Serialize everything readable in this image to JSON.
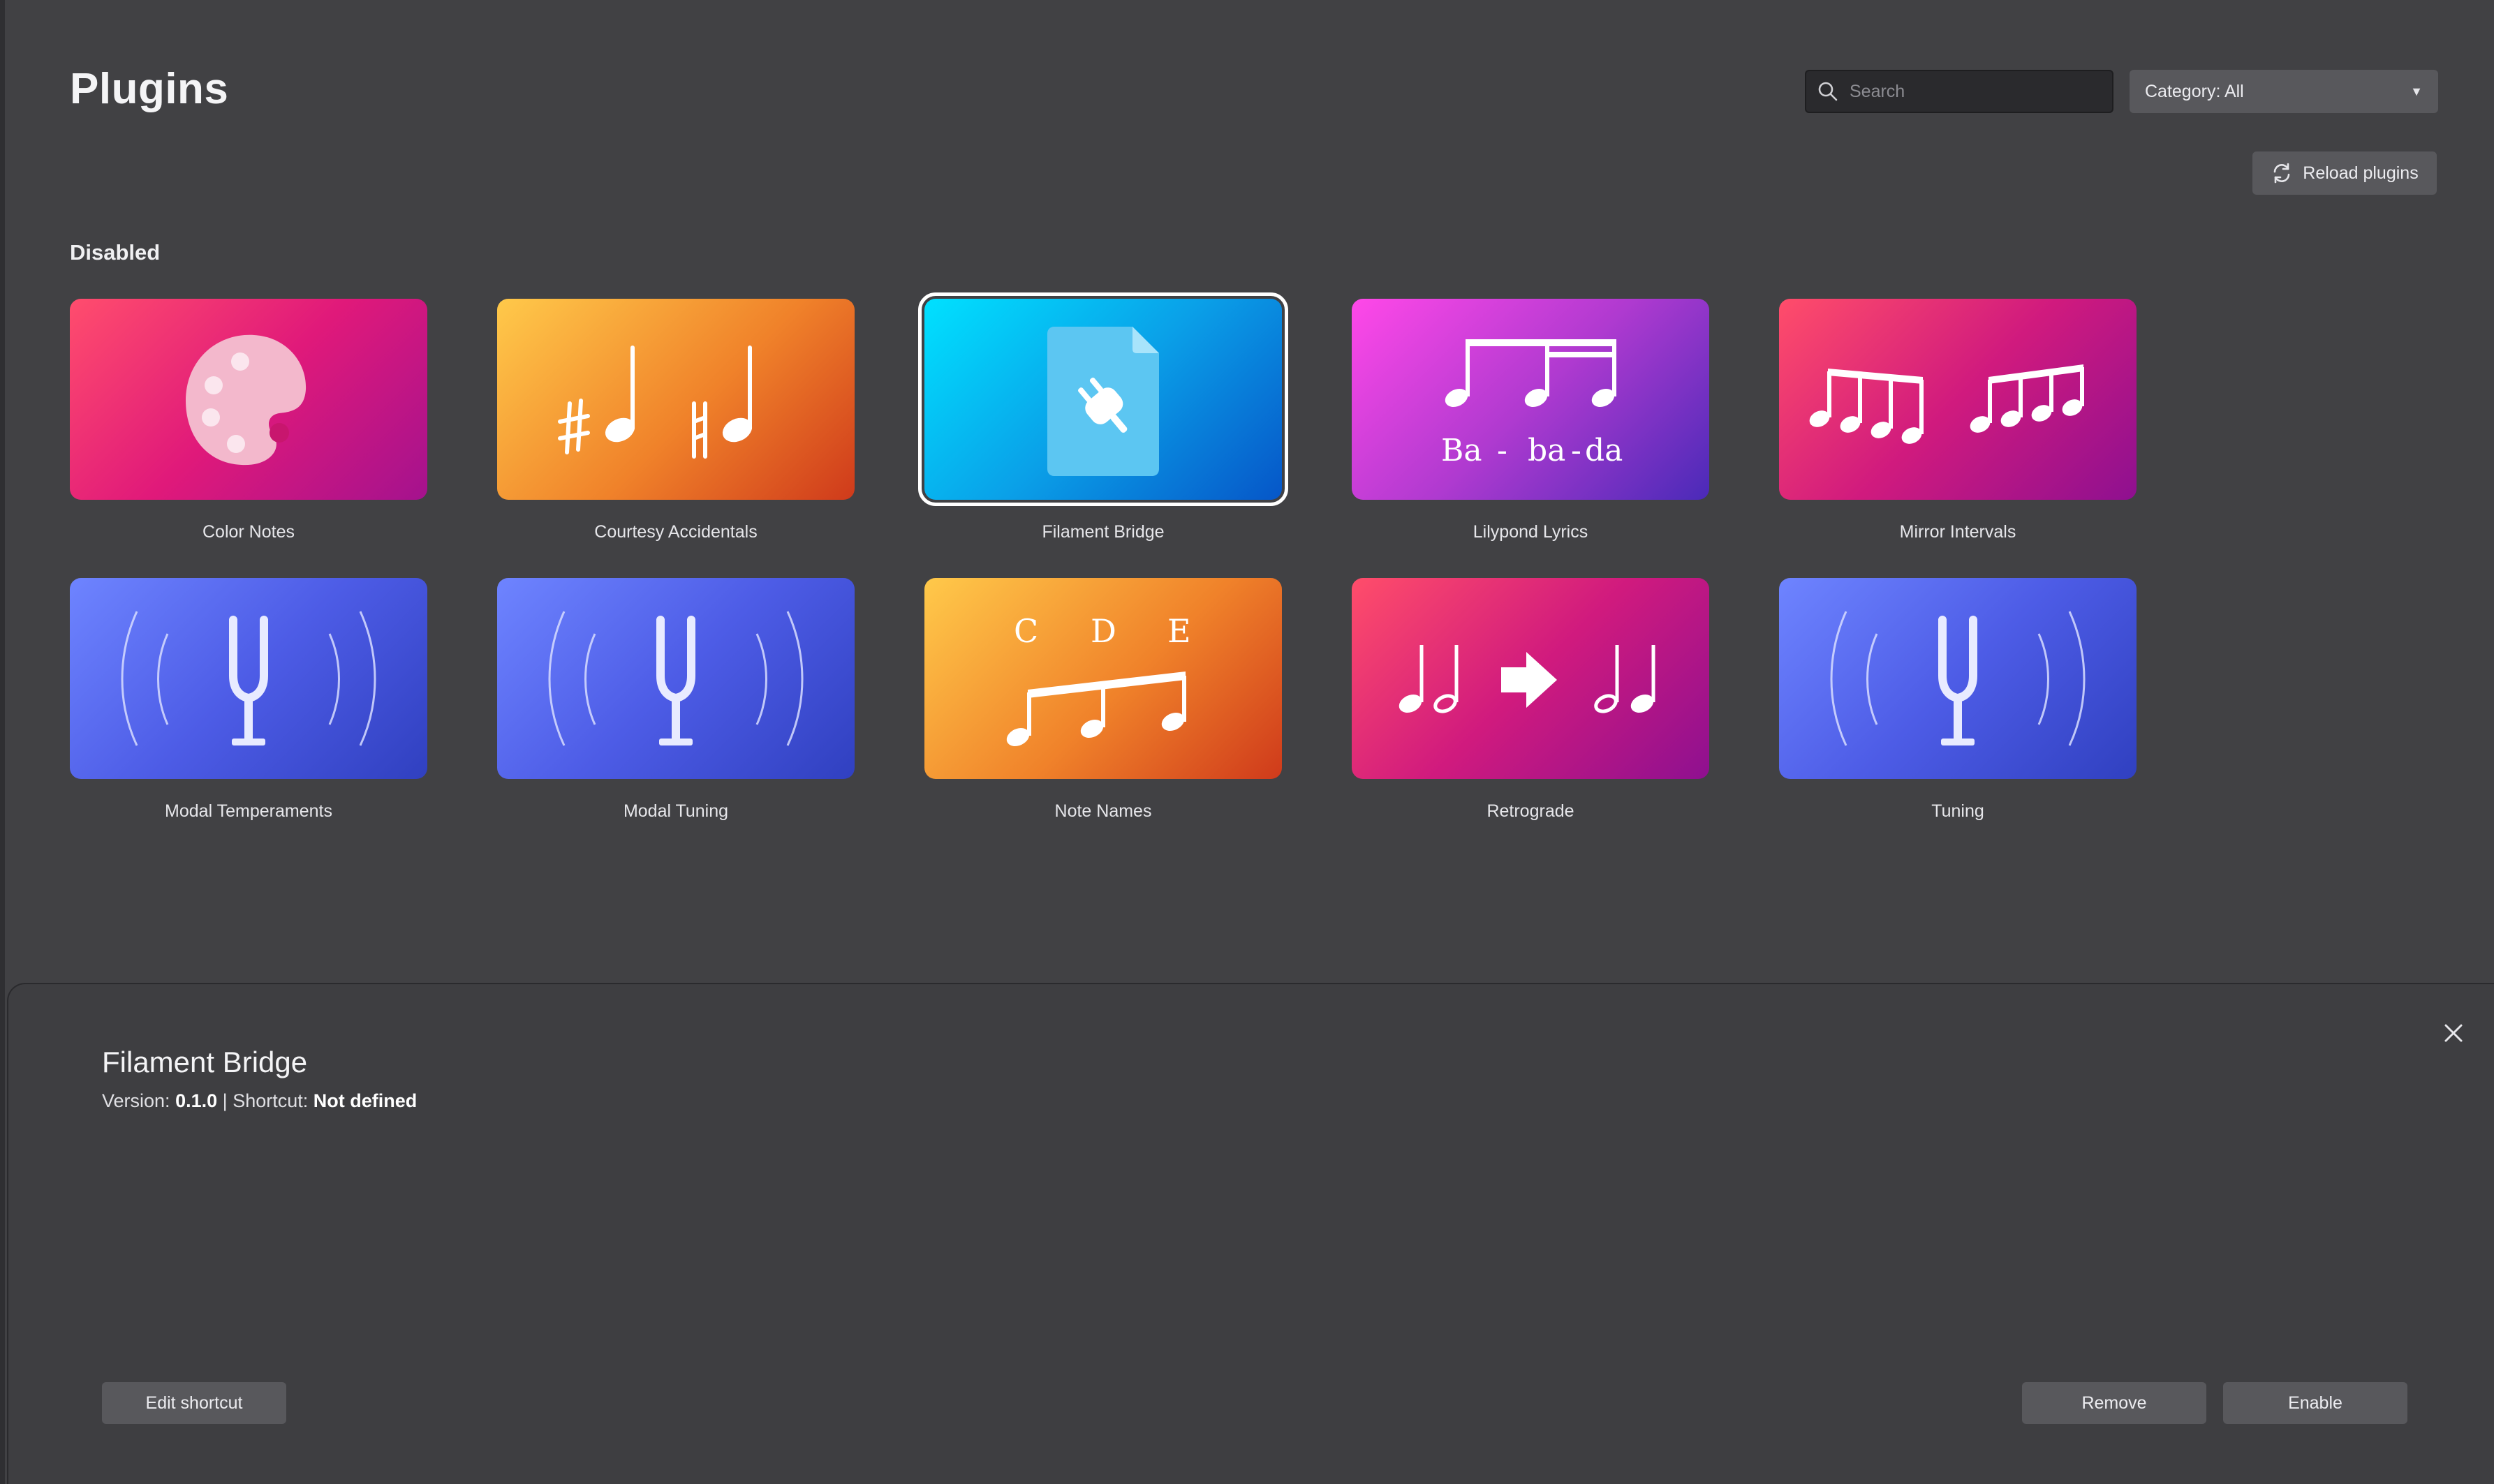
{
  "header": {
    "title": "Plugins",
    "search_placeholder": "Search",
    "category_label": "Category: All",
    "reload_label": "Reload plugins"
  },
  "section": {
    "label": "Disabled"
  },
  "plugins": [
    {
      "name": "Color Notes",
      "icon": "palette-icon"
    },
    {
      "name": "Courtesy Accidentals",
      "icon": "accidentals-icon"
    },
    {
      "name": "Filament Bridge",
      "icon": "plugin-file-icon",
      "selected": true
    },
    {
      "name": "Lilypond Lyrics",
      "icon": "lyrics-notes-icon"
    },
    {
      "name": "Mirror Intervals",
      "icon": "mirror-notes-icon"
    },
    {
      "name": "Modal Temperaments",
      "icon": "tuning-fork-icon"
    },
    {
      "name": "Modal Tuning",
      "icon": "tuning-fork-icon"
    },
    {
      "name": "Note Names",
      "icon": "note-names-icon"
    },
    {
      "name": "Retrograde",
      "icon": "retrograde-icon"
    },
    {
      "name": "Tuning",
      "icon": "tuning-fork-icon"
    }
  ],
  "art_text": {
    "lyrics_1": "Ba",
    "lyrics_2": "-",
    "lyrics_3": "ba",
    "lyrics_4": "-",
    "lyrics_5": "da",
    "note_c": "C",
    "note_d": "D",
    "note_e": "E"
  },
  "details": {
    "title": "Filament Bridge",
    "version_label": "Version:",
    "version": "0.1.0",
    "separator": "|",
    "shortcut_label": "Shortcut:",
    "shortcut": "Not defined",
    "edit_shortcut_label": "Edit shortcut",
    "remove_label": "Remove",
    "enable_label": "Enable"
  },
  "colors": {
    "background": "#414144",
    "panel": "#3e3e41",
    "button": "#58585c",
    "search_bg": "#2a2a2d"
  }
}
